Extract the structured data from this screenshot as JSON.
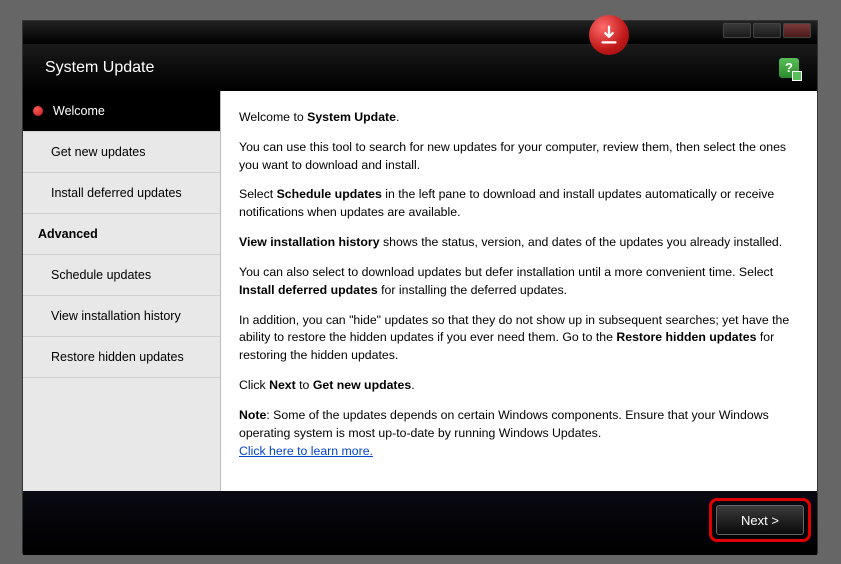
{
  "header": {
    "title": "System Update"
  },
  "sidebar": {
    "items": [
      {
        "label": "Welcome",
        "type": "item",
        "active": true
      },
      {
        "label": "Get new updates",
        "type": "item"
      },
      {
        "label": "Install deferred updates",
        "type": "item"
      },
      {
        "label": "Advanced",
        "type": "header"
      },
      {
        "label": "Schedule updates",
        "type": "item"
      },
      {
        "label": "View installation history",
        "type": "item"
      },
      {
        "label": "Restore hidden updates",
        "type": "item"
      }
    ]
  },
  "content": {
    "welcome_prefix": "Welcome to ",
    "welcome_bold": "System Update",
    "welcome_suffix": ".",
    "p1": "You can use this tool to search for new updates for your computer, review them, then select the ones you want to download and install.",
    "p2_prefix": "Select ",
    "p2_bold": "Schedule updates",
    "p2_suffix": " in the left pane to download and install updates automatically or receive notifications when updates are available.",
    "p3_bold": "View installation history",
    "p3_suffix": " shows the status, version, and dates of the updates you already installed.",
    "p4_prefix": "You can also select to download updates but defer installation until a more convenient time. Select ",
    "p4_bold": "Install deferred updates",
    "p4_suffix": " for installing the deferred updates.",
    "p5_prefix": "In addition, you can \"hide\" updates so that they do not show up in subsequent searches; yet have the ability to restore the hidden updates if you ever need them. Go to the ",
    "p5_bold": "Restore hidden updates",
    "p5_suffix": " for restoring the hidden updates.",
    "p6_prefix": "Click ",
    "p6_bold1": "Next",
    "p6_mid": " to ",
    "p6_bold2": "Get new updates",
    "p6_suffix": ".",
    "note_bold": "Note",
    "note_text": ": Some of the updates depends on certain Windows components. Ensure that your Windows operating system is most up-to-date by running Windows Updates.",
    "link": "Click here to learn more."
  },
  "footer": {
    "next_label": "Next >"
  }
}
